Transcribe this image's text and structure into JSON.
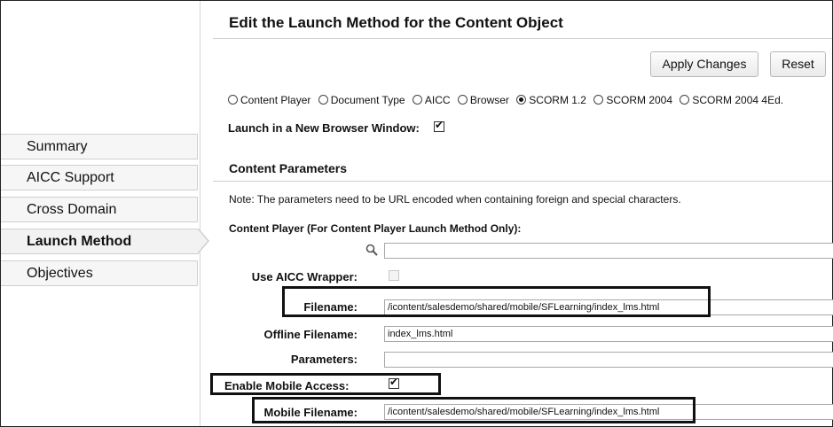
{
  "sidebar": {
    "items": [
      {
        "label": "Summary"
      },
      {
        "label": "AICC Support"
      },
      {
        "label": "Cross Domain"
      },
      {
        "label": "Launch Method",
        "active": true
      },
      {
        "label": "Objectives"
      }
    ]
  },
  "main": {
    "title": "Edit the Launch Method for the Content Object",
    "apply_label": "Apply Changes",
    "reset_label": "Reset",
    "launch_options": [
      {
        "label": "Content Player",
        "selected": false
      },
      {
        "label": "Document Type",
        "selected": false
      },
      {
        "label": "AICC",
        "selected": false
      },
      {
        "label": "Browser",
        "selected": false
      },
      {
        "label": "SCORM 1.2",
        "selected": true
      },
      {
        "label": "SCORM 2004",
        "selected": false
      },
      {
        "label": "SCORM 2004 4Ed.",
        "selected": false
      }
    ],
    "new_window_label": "Launch in a New Browser Window:",
    "new_window_checked": true,
    "content_parameters_title": "Content Parameters",
    "note": "Note: The parameters need to be URL encoded when containing foreign and special characters.",
    "content_player_title": "Content Player (For Content Player Launch Method Only):",
    "search_value": "",
    "use_aicc_wrapper_label": "Use AICC Wrapper:",
    "use_aicc_wrapper_checked": false,
    "filename_label": "Filename:",
    "filename_value": "/icontent/salesdemo/shared/mobile/SFLearning/index_lms.html",
    "offline_filename_label": "Offline Filename:",
    "offline_filename_value": "index_lms.html",
    "parameters_label": "Parameters:",
    "parameters_value": "",
    "enable_mobile_label": "Enable Mobile Access:",
    "enable_mobile_checked": true,
    "mobile_filename_label": "Mobile Filename:",
    "mobile_filename_value": "/icontent/salesdemo/shared/mobile/SFLearning/index_lms.html"
  },
  "colors": {
    "highlight_border": "#111111",
    "sidebar_bg": "#f6f6f6",
    "divider": "#cfcfcf"
  }
}
